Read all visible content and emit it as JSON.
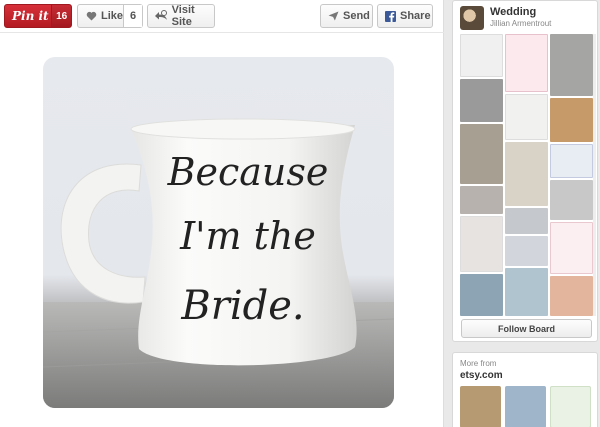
{
  "toolbar": {
    "pinit_label": "Pin it",
    "pinit_count": "16",
    "like_label": "Like",
    "like_count": "6",
    "visit_label": "Visit Site",
    "send_label": "Send",
    "share_label": "Share"
  },
  "pin": {
    "mug_text_line1": "Because",
    "mug_text_line2": "I'm the",
    "mug_text_line3": "Bride."
  },
  "board": {
    "name": "Wedding",
    "owner": "Jillian Armentrout",
    "follow_label": "Follow Board"
  },
  "more_from": {
    "label": "More from",
    "source": "etsy.com"
  },
  "colors": {
    "pinterest_red": "#cb2027",
    "facebook_blue": "#3b5998"
  }
}
